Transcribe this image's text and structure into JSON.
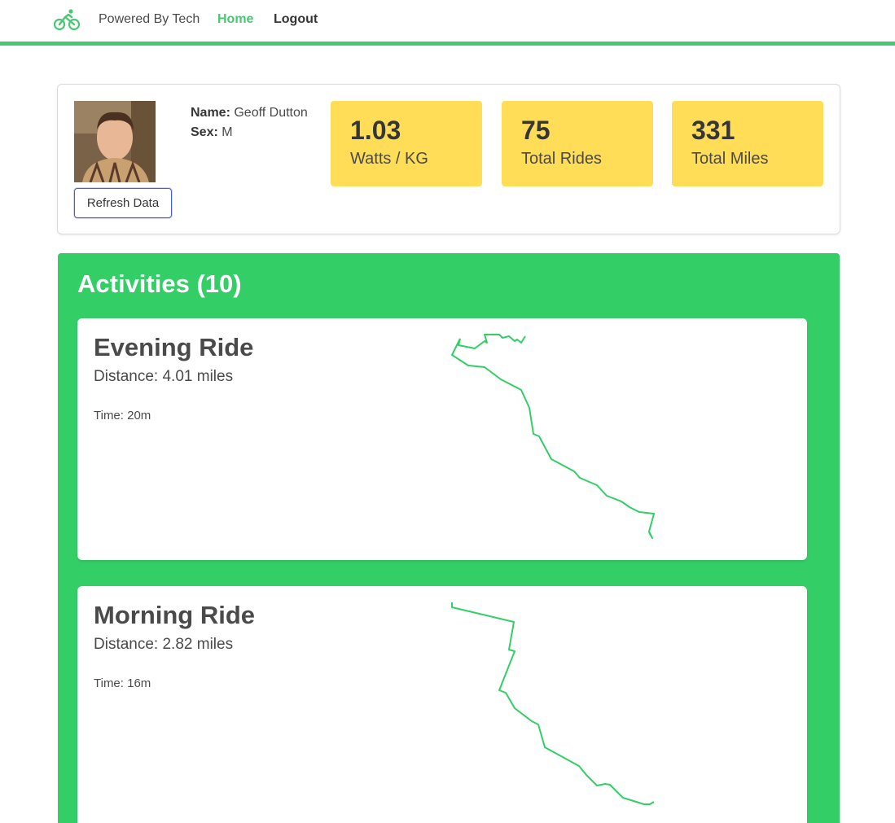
{
  "nav": {
    "brand_icon": "bicycle-icon",
    "brand_text": "Powered By Tech",
    "home_label": "Home",
    "logout_label": "Logout",
    "accent_color": "#48c774"
  },
  "profile": {
    "name_label": "Name:",
    "name_value": "Geoff Dutton",
    "sex_label": "Sex:",
    "sex_value": "M",
    "refresh_label": "Refresh Data"
  },
  "stats": [
    {
      "value": "1.03",
      "label": "Watts / KG"
    },
    {
      "value": "75",
      "label": "Total Rides"
    },
    {
      "value": "331",
      "label": "Total Miles"
    }
  ],
  "stat_color": "#ffdd57",
  "activities": {
    "title": "Activities (10)",
    "background_color": "#33cf66",
    "items": [
      {
        "title": "Evening Ride",
        "distance": "Distance: 4.01 miles",
        "time": "Time: 20m",
        "route_icon": "route-map-line"
      },
      {
        "title": "Morning Ride",
        "distance": "Distance: 2.82 miles",
        "time": "Time: 16m",
        "route_icon": "route-map-line"
      }
    ]
  }
}
